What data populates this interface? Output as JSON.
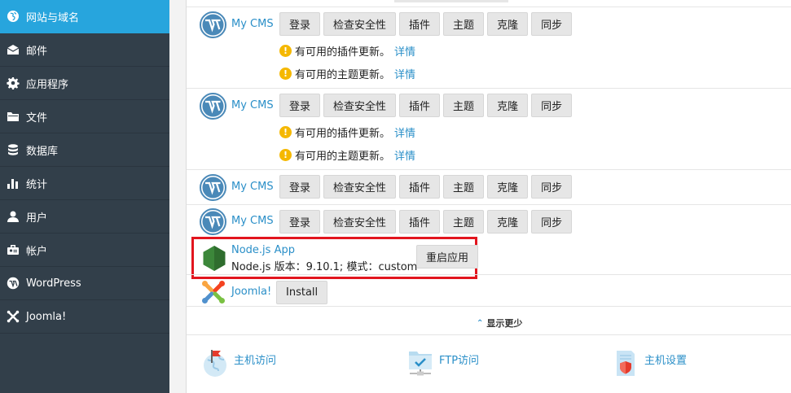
{
  "sidebar": {
    "items": [
      {
        "label": "网站与域名",
        "icon": "globe-icon",
        "active": true
      },
      {
        "label": "邮件",
        "icon": "envelope-icon"
      },
      {
        "label": "应用程序",
        "icon": "gear-icon"
      },
      {
        "label": "文件",
        "icon": "folder-icon"
      },
      {
        "label": "数据库",
        "icon": "database-icon"
      },
      {
        "label": "统计",
        "icon": "bar-chart-icon"
      },
      {
        "label": "用户",
        "icon": "user-icon"
      },
      {
        "label": "帐户",
        "icon": "briefcase-icon"
      },
      {
        "label": "WordPress",
        "icon": "wordpress-icon"
      },
      {
        "label": "Joomla!",
        "icon": "joomla-icon"
      }
    ]
  },
  "apps": [
    {
      "name": "My CMS",
      "buttons": [
        "登录",
        "检查安全性",
        "插件",
        "主题",
        "克隆",
        "同步"
      ],
      "notices": [
        {
          "text": "有可用的插件更新。",
          "link": "详情"
        },
        {
          "text": "有可用的主题更新。",
          "link": "详情"
        }
      ]
    },
    {
      "name": "My CMS",
      "buttons": [
        "登录",
        "检查安全性",
        "插件",
        "主题",
        "克隆",
        "同步"
      ],
      "notices": [
        {
          "text": "有可用的插件更新。",
          "link": "详情"
        },
        {
          "text": "有可用的主题更新。",
          "link": "详情"
        }
      ]
    },
    {
      "name": "My CMS",
      "buttons": [
        "登录",
        "检查安全性",
        "插件",
        "主题",
        "克隆",
        "同步"
      ]
    },
    {
      "name": "My CMS",
      "buttons": [
        "登录",
        "检查安全性",
        "插件",
        "主题",
        "克隆",
        "同步"
      ]
    }
  ],
  "node": {
    "name": "Node.js App",
    "info": "Node.js 版本：9.10.1; 模式：custom",
    "restart": "重启应用"
  },
  "joomla": {
    "name": "Joomla!",
    "install": "Install"
  },
  "show_less": "显示更少",
  "quick_links": [
    {
      "label": "主机访问",
      "icon": "host-access-icon"
    },
    {
      "label": "FTP访问",
      "icon": "ftp-access-icon"
    },
    {
      "label": "主机设置",
      "icon": "host-settings-icon"
    }
  ],
  "colors": {
    "sidebar_bg": "#323f4a",
    "active": "#27a5dd",
    "link": "#2a8fc8",
    "warning": "#f5b800",
    "highlight": "#e2151e"
  }
}
